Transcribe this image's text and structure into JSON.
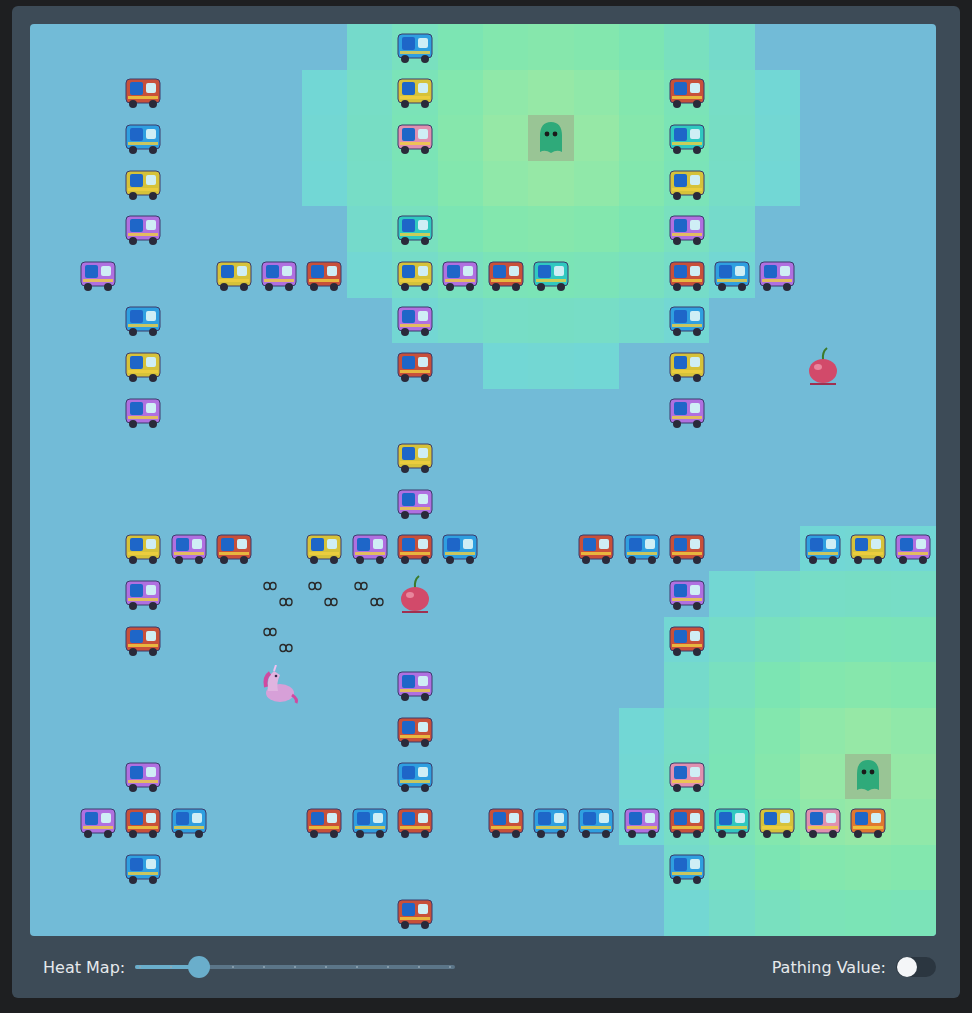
{
  "grid": {
    "rows": 20,
    "cols": 20
  },
  "obstacles": [
    {
      "row": 0,
      "col": 8,
      "color": "#2f9fe0"
    },
    {
      "row": 1,
      "col": 2,
      "color": "#c8503a"
    },
    {
      "row": 1,
      "col": 8,
      "color": "#d6c23a"
    },
    {
      "row": 1,
      "col": 14,
      "color": "#c8503a"
    },
    {
      "row": 2,
      "col": 2,
      "color": "#2f9fe0"
    },
    {
      "row": 2,
      "col": 8,
      "color": "#e090b0"
    },
    {
      "row": 2,
      "col": 14,
      "color": "#30c8c0"
    },
    {
      "row": 3,
      "col": 2,
      "color": "#d6c23a"
    },
    {
      "row": 3,
      "col": 14,
      "color": "#d6c23a"
    },
    {
      "row": 4,
      "col": 2,
      "color": "#b070e0"
    },
    {
      "row": 4,
      "col": 8,
      "color": "#30c8c0"
    },
    {
      "row": 4,
      "col": 14,
      "color": "#b070e0"
    },
    {
      "row": 5,
      "col": 1,
      "color": "#b070e0"
    },
    {
      "row": 5,
      "col": 4,
      "color": "#d6c23a"
    },
    {
      "row": 5,
      "col": 5,
      "color": "#b070e0"
    },
    {
      "row": 5,
      "col": 6,
      "color": "#c8503a"
    },
    {
      "row": 5,
      "col": 8,
      "color": "#d6c23a"
    },
    {
      "row": 5,
      "col": 9,
      "color": "#b070e0"
    },
    {
      "row": 5,
      "col": 10,
      "color": "#c8503a"
    },
    {
      "row": 5,
      "col": 11,
      "color": "#30c8c0"
    },
    {
      "row": 5,
      "col": 14,
      "color": "#c8503a"
    },
    {
      "row": 5,
      "col": 15,
      "color": "#2f9fe0"
    },
    {
      "row": 5,
      "col": 16,
      "color": "#b070e0"
    },
    {
      "row": 6,
      "col": 2,
      "color": "#2f9fe0"
    },
    {
      "row": 6,
      "col": 8,
      "color": "#b070e0"
    },
    {
      "row": 6,
      "col": 14,
      "color": "#2f9fe0"
    },
    {
      "row": 7,
      "col": 2,
      "color": "#d6c23a"
    },
    {
      "row": 7,
      "col": 8,
      "color": "#c8503a"
    },
    {
      "row": 7,
      "col": 14,
      "color": "#d6c23a"
    },
    {
      "row": 8,
      "col": 2,
      "color": "#b070e0"
    },
    {
      "row": 8,
      "col": 14,
      "color": "#b070e0"
    },
    {
      "row": 9,
      "col": 8,
      "color": "#d6c23a"
    },
    {
      "row": 10,
      "col": 8,
      "color": "#b070e0"
    },
    {
      "row": 11,
      "col": 2,
      "color": "#d6c23a"
    },
    {
      "row": 11,
      "col": 3,
      "color": "#b070e0"
    },
    {
      "row": 11,
      "col": 4,
      "color": "#c8503a"
    },
    {
      "row": 11,
      "col": 6,
      "color": "#d6c23a"
    },
    {
      "row": 11,
      "col": 7,
      "color": "#b070e0"
    },
    {
      "row": 11,
      "col": 8,
      "color": "#c8503a"
    },
    {
      "row": 11,
      "col": 9,
      "color": "#2f9fe0"
    },
    {
      "row": 11,
      "col": 12,
      "color": "#c8503a"
    },
    {
      "row": 11,
      "col": 13,
      "color": "#2f9fe0"
    },
    {
      "row": 11,
      "col": 14,
      "color": "#c8503a"
    },
    {
      "row": 11,
      "col": 17,
      "color": "#2f9fe0"
    },
    {
      "row": 11,
      "col": 18,
      "color": "#d6c23a"
    },
    {
      "row": 11,
      "col": 19,
      "color": "#b070e0"
    },
    {
      "row": 12,
      "col": 2,
      "color": "#b070e0"
    },
    {
      "row": 12,
      "col": 14,
      "color": "#b070e0"
    },
    {
      "row": 13,
      "col": 2,
      "color": "#c8503a"
    },
    {
      "row": 13,
      "col": 14,
      "color": "#c8503a"
    },
    {
      "row": 14,
      "col": 8,
      "color": "#b070e0"
    },
    {
      "row": 15,
      "col": 8,
      "color": "#c8503a"
    },
    {
      "row": 16,
      "col": 2,
      "color": "#b070e0"
    },
    {
      "row": 16,
      "col": 8,
      "color": "#2f9fe0"
    },
    {
      "row": 16,
      "col": 14,
      "color": "#e090b0"
    },
    {
      "row": 17,
      "col": 1,
      "color": "#b070e0"
    },
    {
      "row": 17,
      "col": 2,
      "color": "#c8503a"
    },
    {
      "row": 17,
      "col": 3,
      "color": "#2f9fe0"
    },
    {
      "row": 17,
      "col": 6,
      "color": "#c8503a"
    },
    {
      "row": 17,
      "col": 7,
      "color": "#2f9fe0"
    },
    {
      "row": 17,
      "col": 8,
      "color": "#c8503a"
    },
    {
      "row": 17,
      "col": 10,
      "color": "#c8503a"
    },
    {
      "row": 17,
      "col": 11,
      "color": "#2f9fe0"
    },
    {
      "row": 17,
      "col": 12,
      "color": "#2f9fe0"
    },
    {
      "row": 17,
      "col": 13,
      "color": "#b070e0"
    },
    {
      "row": 17,
      "col": 14,
      "color": "#c8503a"
    },
    {
      "row": 17,
      "col": 15,
      "color": "#30c8c0"
    },
    {
      "row": 17,
      "col": 16,
      "color": "#d6c23a"
    },
    {
      "row": 17,
      "col": 17,
      "color": "#e090b0"
    },
    {
      "row": 17,
      "col": 18,
      "color": "#e07830"
    },
    {
      "row": 18,
      "col": 2,
      "color": "#2f9fe0"
    },
    {
      "row": 18,
      "col": 14,
      "color": "#2f9fe0"
    },
    {
      "row": 19,
      "col": 8,
      "color": "#c8503a"
    }
  ],
  "cherries": [
    {
      "row": 7,
      "col": 17
    },
    {
      "row": 12,
      "col": 8
    }
  ],
  "ghosts": [
    {
      "row": 2,
      "col": 11
    },
    {
      "row": 16,
      "col": 18
    }
  ],
  "agent": {
    "row": 14,
    "col": 5
  },
  "path": [
    {
      "row": 13,
      "col": 5
    },
    {
      "row": 12,
      "col": 5
    },
    {
      "row": 12,
      "col": 6
    },
    {
      "row": 12,
      "col": 7
    }
  ],
  "controls": {
    "heat_map": {
      "label": "Heat Map:",
      "level": 0.2
    },
    "pathing_value": {
      "label": "Pathing Value:",
      "on": false
    }
  }
}
